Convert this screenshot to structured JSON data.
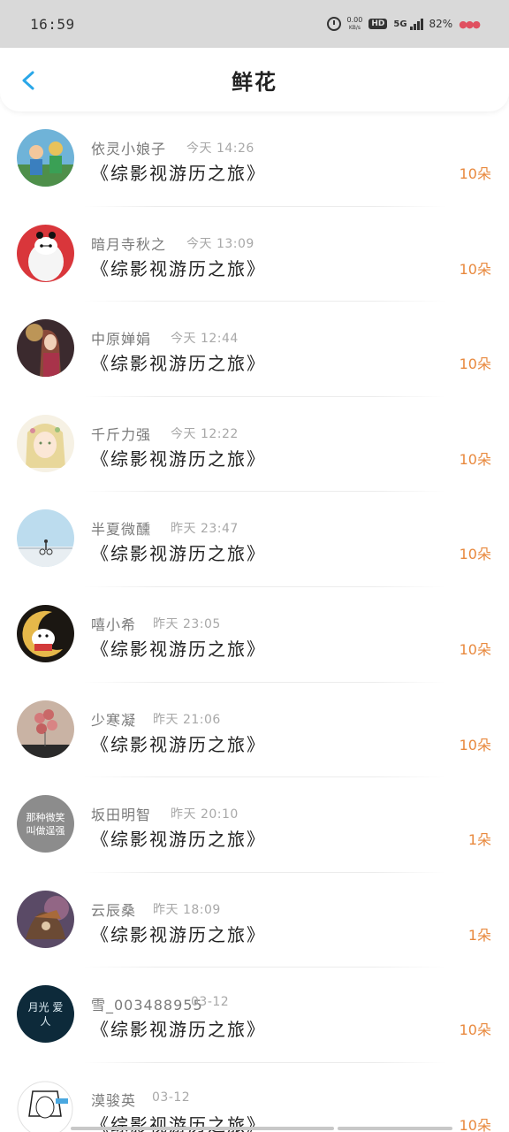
{
  "status_bar": {
    "time": "16:59",
    "net_speed_value": "0.00",
    "net_speed_unit": "KB/s",
    "hd": "HD",
    "network": "5G",
    "battery": "82%"
  },
  "header": {
    "title": "鲜花"
  },
  "rows": [
    {
      "name": "依灵小娘子",
      "time": "今天 14:26",
      "book": "《综影视游历之旅》",
      "count": "10朵"
    },
    {
      "name": "暗月寺秋之",
      "time": "今天 13:09",
      "book": "《综影视游历之旅》",
      "count": "10朵"
    },
    {
      "name": "中原婵娟",
      "time": "今天 12:44",
      "book": "《综影视游历之旅》",
      "count": "10朵"
    },
    {
      "name": "千斤力强",
      "time": "今天 12:22",
      "book": "《综影视游历之旅》",
      "count": "10朵"
    },
    {
      "name": "半夏微醺",
      "time": "昨天 23:47",
      "book": "《综影视游历之旅》",
      "count": "10朵"
    },
    {
      "name": "嘻小希",
      "time": "昨天 23:05",
      "book": "《综影视游历之旅》",
      "count": "10朵"
    },
    {
      "name": "少寒凝",
      "time": "昨天 21:06",
      "book": "《综影视游历之旅》",
      "count": "10朵"
    },
    {
      "name": "坂田明智",
      "time": "昨天 20:10",
      "book": "《综影视游历之旅》",
      "count": "1朵"
    },
    {
      "name": "云辰桑",
      "time": "昨天 18:09",
      "book": "《综影视游历之旅》",
      "count": "1朵"
    },
    {
      "name": "雪_003488955",
      "time": "03-12",
      "book": "《综影视游历之旅》",
      "count": "10朵"
    },
    {
      "name": "漠骏英",
      "time": "03-12",
      "book": "《综影视游历之旅》",
      "count": "10朵"
    }
  ],
  "avatar_text": {
    "row8": "那种微笑 叫做逞强",
    "row10": "月光 爱人"
  },
  "colors": {
    "accent_blue": "#2aa7e8",
    "count_orange": "#e8893e",
    "status_bg": "#d9d9d9"
  }
}
